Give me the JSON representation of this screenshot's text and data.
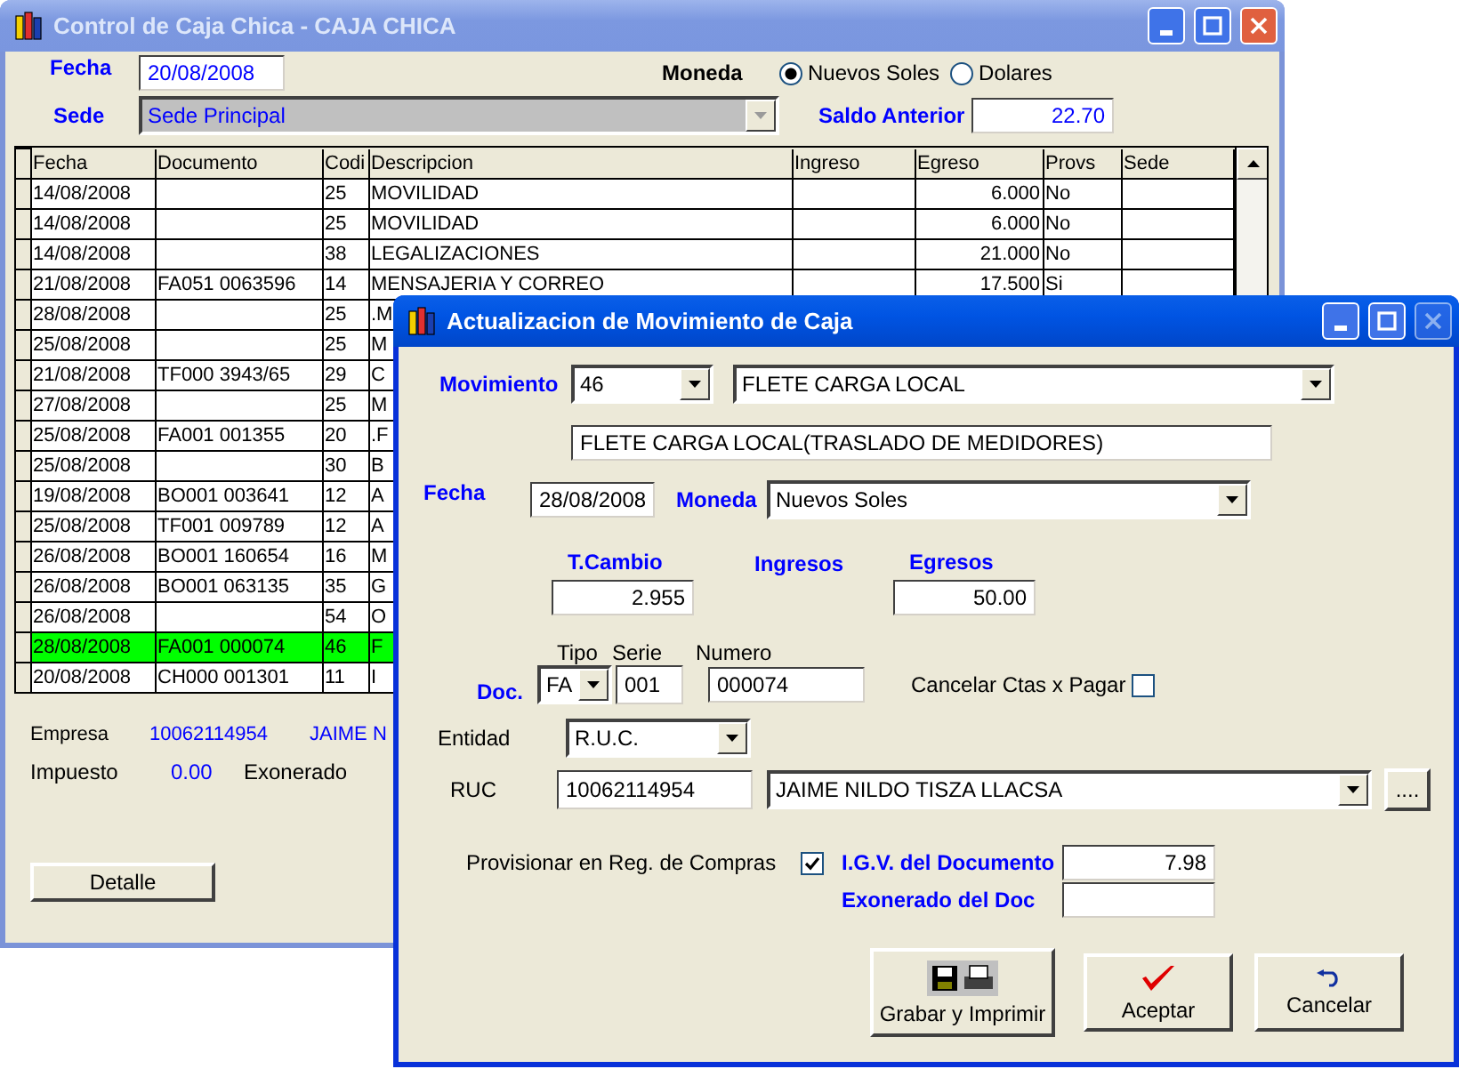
{
  "main_window": {
    "title": "Control de Caja Chica - CAJA CHICA",
    "active": false,
    "fecha_label": "Fecha",
    "fecha": "20/08/2008",
    "moneda_label": "Moneda",
    "moneda_options": [
      {
        "label": "Nuevos Soles",
        "selected": true
      },
      {
        "label": "Dolares",
        "selected": false
      }
    ],
    "sede_label": "Sede",
    "sede": {
      "value": "Sede Principal",
      "disabled": true
    },
    "saldo_label": "Saldo Anterior",
    "saldo": "22.70",
    "table": {
      "columns": [
        "Fecha",
        "Documento",
        "Codi",
        "Descripcion",
        "Ingreso",
        "Egreso",
        "Provs",
        "Sede"
      ],
      "rows": [
        {
          "fecha": "14/08/2008",
          "codigo": "25",
          "descripcion": "MOVILIDAD",
          "egreso": "6.000",
          "provs": "No",
          "selected": false
        },
        {
          "fecha": "14/08/2008",
          "codigo": "25",
          "descripcion": "MOVILIDAD",
          "egreso": "6.000",
          "provs": "No",
          "selected": false
        },
        {
          "fecha": "14/08/2008",
          "codigo": "38",
          "descripcion": "LEGALIZACIONES",
          "egreso": "21.000",
          "provs": "No",
          "selected": false
        },
        {
          "fecha": "21/08/2008",
          "documento": "FA051 0063596",
          "codigo": "14",
          "descripcion": "MENSAJERIA Y CORREO",
          "egreso": "17.500",
          "provs": "Si",
          "selected": false
        },
        {
          "fecha": "28/08/2008",
          "codigo": "25",
          "descripcion": ".M",
          "selected": false
        },
        {
          "fecha": "25/08/2008",
          "codigo": "25",
          "descripcion": "M",
          "selected": false
        },
        {
          "fecha": "21/08/2008",
          "documento": "TF000 3943/65",
          "codigo": "29",
          "descripcion": "C",
          "selected": false
        },
        {
          "fecha": "27/08/2008",
          "codigo": "25",
          "descripcion": "M",
          "selected": false
        },
        {
          "fecha": "25/08/2008",
          "documento": "FA001 001355",
          "codigo": "20",
          "descripcion": ".F",
          "selected": false
        },
        {
          "fecha": "25/08/2008",
          "codigo": "30",
          "descripcion": "B",
          "selected": false
        },
        {
          "fecha": "19/08/2008",
          "documento": "BO001 003641",
          "codigo": "12",
          "descripcion": "A",
          "selected": false
        },
        {
          "fecha": "25/08/2008",
          "documento": "TF001 009789",
          "codigo": "12",
          "descripcion": "A",
          "selected": false
        },
        {
          "fecha": "26/08/2008",
          "documento": "BO001 160654",
          "codigo": "16",
          "descripcion": "M",
          "selected": false
        },
        {
          "fecha": "26/08/2008",
          "documento": "BO001 063135",
          "codigo": "35",
          "descripcion": "G",
          "selected": false
        },
        {
          "fecha": "26/08/2008",
          "codigo": "54",
          "descripcion": "O",
          "selected": false
        },
        {
          "fecha": "28/08/2008",
          "documento": "FA001 000074",
          "codigo": "46",
          "descripcion": "F",
          "selected": true
        },
        {
          "fecha": "20/08/2008",
          "documento": "CH000 001301",
          "codigo": "11",
          "descripcion": "I",
          "selected": false
        }
      ]
    },
    "empresa_label": "Empresa",
    "empresa_ruc": "10062114954",
    "empresa_name": "JAIME N",
    "impuesto_label": "Impuesto",
    "impuesto": "0.00",
    "exonerado_label": "Exonerado",
    "detalle_button": "Detalle"
  },
  "dialog": {
    "title": "Actualizacion de Movimiento de Caja",
    "active": true,
    "close_disabled": true,
    "movimiento_label": "Movimiento",
    "movimiento_code": "46",
    "movimiento_name": "FLETE CARGA LOCAL",
    "descripcion": "FLETE CARGA LOCAL(TRASLADO DE MEDIDORES)",
    "fecha_label": "Fecha",
    "fecha": "28/08/2008",
    "moneda_label": "Moneda",
    "moneda": "Nuevos Soles",
    "tcambio_label": "T.Cambio",
    "ingresos_label": "Ingresos",
    "egresos_label": "Egresos",
    "tcambio": "2.955",
    "egresos": "50.00",
    "tipo_label": "Tipo",
    "serie_label": "Serie",
    "numero_label": "Numero",
    "doc_label": "Doc.",
    "tipo": "FA",
    "serie": "001",
    "numero": "000074",
    "cancelar_ctas": {
      "label": "Cancelar Ctas x Pagar",
      "checked": false
    },
    "entidad_label": "Entidad",
    "entidad": "R.U.C.",
    "ruc_label": "RUC",
    "ruc": "10062114954",
    "razon_social": "JAIME NILDO TISZA LLACSA",
    "browse_button": "....",
    "provisionar": {
      "label": "Provisionar en Reg. de Compras",
      "checked": true
    },
    "igv_label": "I.G.V. del Documento",
    "igv": "7.98",
    "exonerado_label": "Exonerado del Doc",
    "buttons": [
      {
        "kind": "save_print",
        "label": "Grabar y Imprimir"
      },
      {
        "kind": "accept",
        "label": "Aceptar"
      },
      {
        "kind": "cancel",
        "label": "Cancelar"
      }
    ]
  }
}
